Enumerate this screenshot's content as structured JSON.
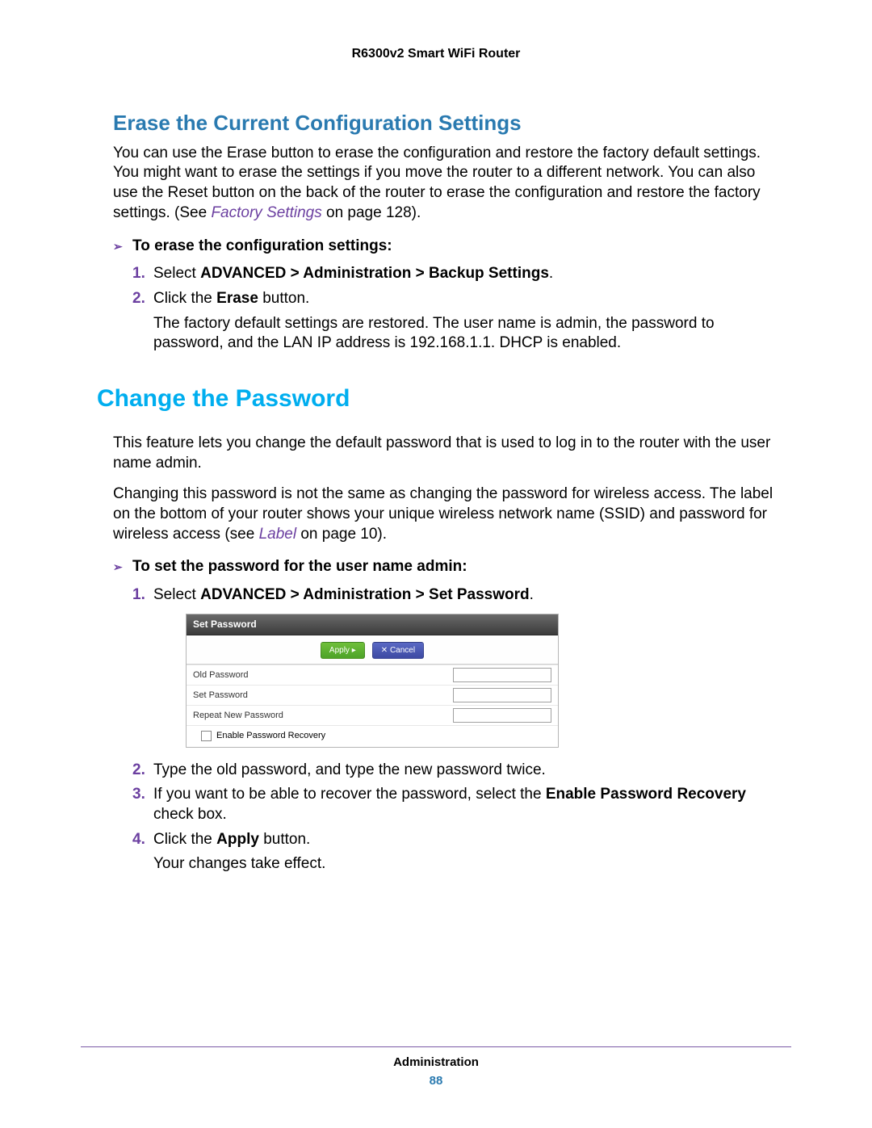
{
  "header": {
    "title": "R6300v2 Smart WiFi Router"
  },
  "section1": {
    "title": "Erase the Current Configuration Settings",
    "p1_a": "You can use the Erase button to erase the configuration and restore the factory default settings. You might want to erase the settings if you move the router to a different network. You can also use the Reset button on the back of the router to erase the configuration and restore the factory settings. (See ",
    "p1_link": "Factory Settings",
    "p1_b": " on page 128).",
    "task_title": "To erase the configuration settings:",
    "step1_a": "Select ",
    "step1_b": "ADVANCED > Administration > Backup Settings",
    "step1_c": ".",
    "step2_a": "Click the ",
    "step2_b": "Erase",
    "step2_c": " button.",
    "step2_sub": "The factory default settings are restored. The user name is admin, the password to password, and the LAN IP address is 192.168.1.1. DHCP is enabled."
  },
  "section2": {
    "title": "Change the Password",
    "p1": "This feature lets you change the default password that is used to log in to the router with the user name admin.",
    "p2_a": "Changing this password is not the same as changing the password for wireless access. The label on the bottom of your router shows your unique wireless network name (SSID) and password for wireless access (see ",
    "p2_link": "Label",
    "p2_b": " on page 10).",
    "task_title": "To set the password for the user name admin:",
    "step1_a": "Select ",
    "step1_b": "ADVANCED > Administration > Set Password",
    "step1_c": ".",
    "panel": {
      "title": "Set Password",
      "apply": "Apply ▸",
      "cancel": "✕ Cancel",
      "row1": "Old Password",
      "row2": "Set Password",
      "row3": "Repeat New Password",
      "row4": "Enable Password Recovery"
    },
    "step2": "Type the old password, and type the new password twice.",
    "step3_a": "If you want to be able to recover the password, select the ",
    "step3_b": "Enable Password Recovery",
    "step3_c": " check box.",
    "step4_a": "Click the ",
    "step4_b": "Apply",
    "step4_c": " button.",
    "step4_sub": "Your changes take effect."
  },
  "footer": {
    "section": "Administration",
    "page": "88"
  }
}
